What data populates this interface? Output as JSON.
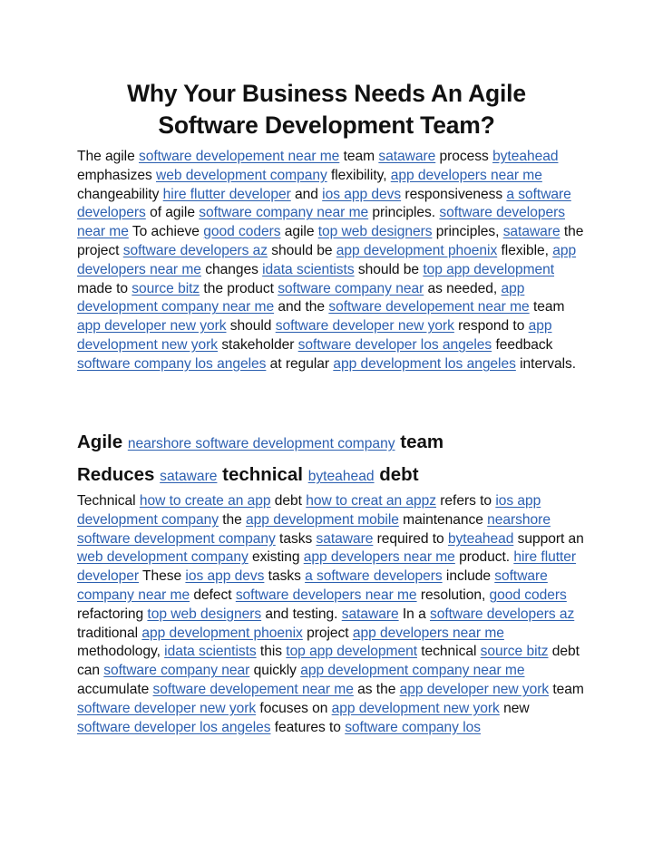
{
  "document": {
    "title": "Why Your Business Needs An Agile Software Development Team?",
    "link_color": "#2b5fb0",
    "paragraph1": [
      {
        "t": "The agile "
      },
      {
        "l": "software developement near me"
      },
      {
        "t": " team "
      },
      {
        "l": "sataware"
      },
      {
        "t": " process "
      },
      {
        "l": "byteahead"
      },
      {
        "t": " emphasizes "
      },
      {
        "l": "web development company"
      },
      {
        "t": " flexibility, "
      },
      {
        "l": "app developers near me"
      },
      {
        "t": " changeability "
      },
      {
        "l": "hire flutter developer"
      },
      {
        "t": " and "
      },
      {
        "l": "ios app devs"
      },
      {
        "t": " responsiveness "
      },
      {
        "l": "a software developers"
      },
      {
        "t": " of agile "
      },
      {
        "l": "software company near me"
      },
      {
        "t": " principles. "
      },
      {
        "l": "software developers near me"
      },
      {
        "t": " To achieve "
      },
      {
        "l": "good coders"
      },
      {
        "t": " agile "
      },
      {
        "l": "top web designers"
      },
      {
        "t": " principles, "
      },
      {
        "l": "sataware"
      },
      {
        "t": " the project "
      },
      {
        "l": "software developers az"
      },
      {
        "t": " should be "
      },
      {
        "l": "app development phoenix"
      },
      {
        "t": " flexible, "
      },
      {
        "l": "app developers near me"
      },
      {
        "t": " changes "
      },
      {
        "l": "idata scientists"
      },
      {
        "t": " should be "
      },
      {
        "l": "top app development"
      },
      {
        "t": " made to "
      },
      {
        "l": "source bitz"
      },
      {
        "t": " the product "
      },
      {
        "l": "software company near"
      },
      {
        "t": " as needed, "
      },
      {
        "l": "app development company near me"
      },
      {
        "t": " and the "
      },
      {
        "l": "software developement near me"
      },
      {
        "t": " team "
      },
      {
        "l": "app developer new york"
      },
      {
        "t": " should "
      },
      {
        "l": "software developer new york"
      },
      {
        "t": " respond to "
      },
      {
        "l": "app development new york"
      },
      {
        "t": " stakeholder "
      },
      {
        "l": "software developer los angeles"
      },
      {
        "t": " feedback "
      },
      {
        "l": "software company los angeles"
      },
      {
        "t": " at regular "
      },
      {
        "l": "app development los angeles"
      },
      {
        "t": " intervals."
      }
    ],
    "heading1": [
      {
        "t": "Agile "
      },
      {
        "l": "nearshore software development company"
      },
      {
        "t": " team"
      }
    ],
    "heading2": [
      {
        "t": "Reduces "
      },
      {
        "l": "sataware"
      },
      {
        "t": " technical "
      },
      {
        "l": "byteahead"
      },
      {
        "t": " debt"
      }
    ],
    "paragraph2": [
      {
        "t": "Technical "
      },
      {
        "l": "how to create an app"
      },
      {
        "t": " debt "
      },
      {
        "l": "how to creat an appz"
      },
      {
        "t": " refers to "
      },
      {
        "l": "ios app development company"
      },
      {
        "t": " the "
      },
      {
        "l": "app development mobile"
      },
      {
        "t": " maintenance "
      },
      {
        "l": "nearshore software development company"
      },
      {
        "t": " tasks "
      },
      {
        "l": "sataware"
      },
      {
        "t": " required to "
      },
      {
        "l": "byteahead"
      },
      {
        "t": " support an "
      },
      {
        "l": "web development company"
      },
      {
        "t": " existing "
      },
      {
        "l": "app developers near me"
      },
      {
        "t": " product. "
      },
      {
        "l": "hire flutter developer"
      },
      {
        "t": " These "
      },
      {
        "l": "ios app devs"
      },
      {
        "t": " tasks "
      },
      {
        "l": "a software developers"
      },
      {
        "t": " include "
      },
      {
        "l": "software company near me"
      },
      {
        "t": " defect "
      },
      {
        "l": "software developers near me"
      },
      {
        "t": " resolution, "
      },
      {
        "l": "good coders"
      },
      {
        "t": " refactoring "
      },
      {
        "l": "top web designers"
      },
      {
        "t": " and testing. "
      },
      {
        "l": "sataware"
      },
      {
        "t": " In a "
      },
      {
        "l": "software developers az"
      },
      {
        "t": " traditional "
      },
      {
        "l": "app development phoenix"
      },
      {
        "t": " project "
      },
      {
        "l": "app developers near me"
      },
      {
        "t": " methodology, "
      },
      {
        "l": "idata scientists"
      },
      {
        "t": " this "
      },
      {
        "l": "top app development"
      },
      {
        "t": " technical "
      },
      {
        "l": "source bitz"
      },
      {
        "t": " debt can "
      },
      {
        "l": "software company near"
      },
      {
        "t": " quickly "
      },
      {
        "l": "app development company near me"
      },
      {
        "t": " accumulate "
      },
      {
        "l": "software developement near me"
      },
      {
        "t": " as the "
      },
      {
        "l": "app developer new york"
      },
      {
        "t": " team "
      },
      {
        "l": "software developer new york"
      },
      {
        "t": " focuses on "
      },
      {
        "l": "app development new york"
      },
      {
        "t": " new "
      },
      {
        "l": "software developer los angeles"
      },
      {
        "t": " features to "
      },
      {
        "l": "software company los"
      }
    ]
  }
}
